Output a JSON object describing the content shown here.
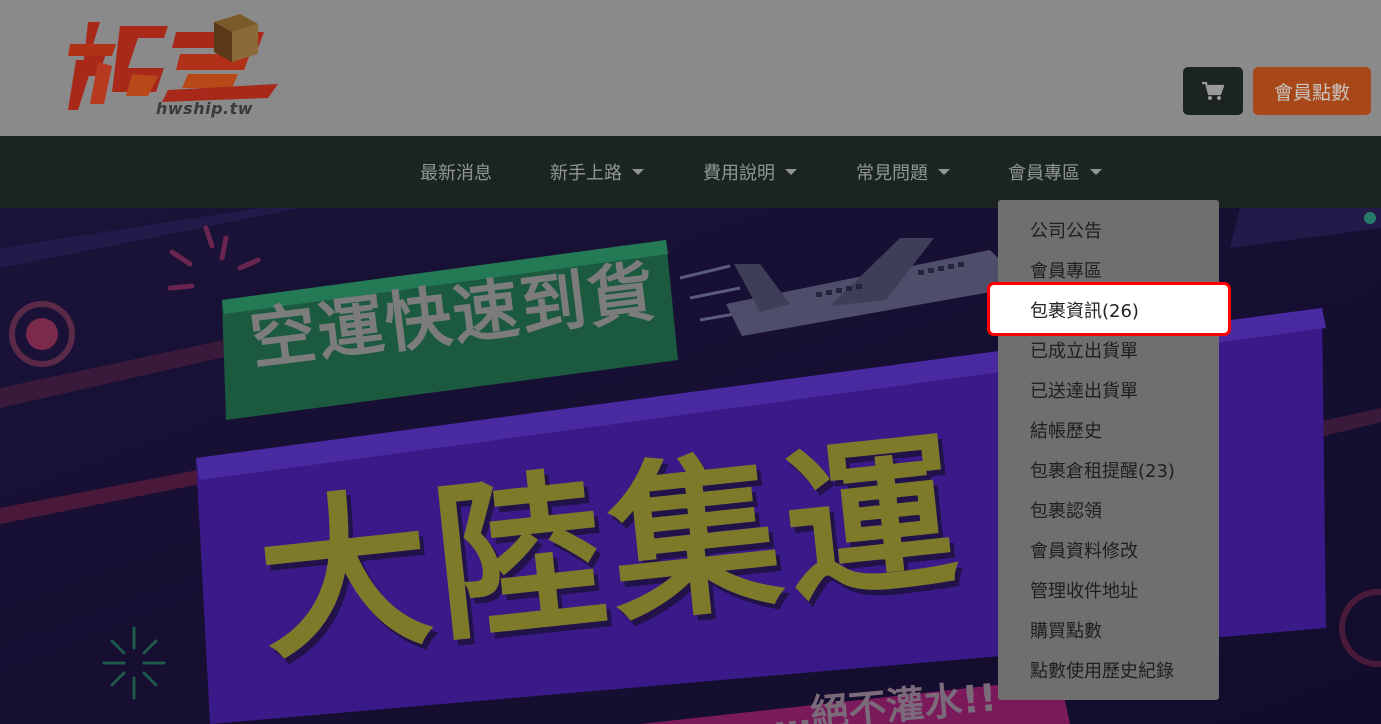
{
  "logo": {
    "domain_text": "hwship.tw"
  },
  "header": {
    "cart_icon": "shopping-cart-icon",
    "points_button_label": "會員點數"
  },
  "nav": {
    "items": [
      {
        "label": "最新消息",
        "has_caret": false
      },
      {
        "label": "新手上路",
        "has_caret": true
      },
      {
        "label": "費用說明",
        "has_caret": true
      },
      {
        "label": "常見問題",
        "has_caret": true
      },
      {
        "label": "會員專區",
        "has_caret": true
      }
    ]
  },
  "hero": {
    "headline_small": "空運快速到貨",
    "headline_large": "大陸集運",
    "bottom_text": "…絕不灌水!!"
  },
  "dropdown": {
    "items": [
      {
        "label": "公司公告"
      },
      {
        "label": "會員專區"
      },
      {
        "label": "包裹資訊(26)",
        "highlighted": true
      },
      {
        "label": "已成立出貨單"
      },
      {
        "label": "已送達出貨單"
      },
      {
        "label": "結帳歷史"
      },
      {
        "label": "包裹倉租提醒(23)"
      },
      {
        "label": "包裹認領"
      },
      {
        "label": "會員資料修改"
      },
      {
        "label": "管理收件地址"
      },
      {
        "label": "購買點數"
      },
      {
        "label": "點數使用歷史紀錄"
      }
    ]
  },
  "colors": {
    "header_bg": "#8a8a8a",
    "nav_bg": "#1b2423",
    "points_button": "#a84818",
    "highlight_border": "#ff0000",
    "logo_red": "#a8281a",
    "logo_orange": "#b8601a"
  }
}
